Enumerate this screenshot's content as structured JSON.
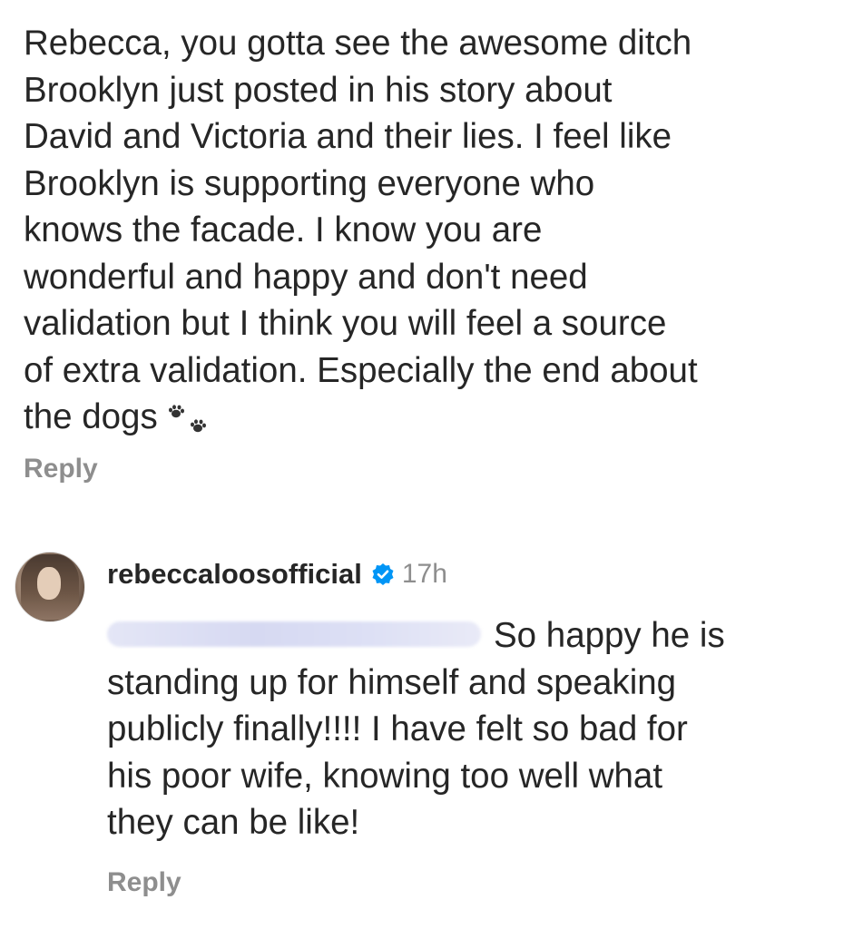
{
  "first_comment": {
    "lines": [
      "Rebecca, you gotta see the awesome ditch",
      "Brooklyn just posted in his story about",
      "David and Victoria and their lies. I feel like",
      "Brooklyn is supporting everyone who",
      "knows the facade. I know you are",
      "wonderful and happy and don't need",
      "validation but I think you will feel a source",
      "of extra validation. Especially the end about",
      "the dogs"
    ],
    "emoji": "paw-prints-icon",
    "reply_label": "Reply"
  },
  "second_comment": {
    "username": "rebeccaloosofficial",
    "verified": true,
    "time": "17h",
    "mention_hidden": true,
    "lines": [
      "So happy he is",
      "standing up for himself and speaking",
      "publicly finally!!!! I have felt so bad for",
      "his poor wife, knowing too well what",
      "they can be like!"
    ],
    "reply_label": "Reply"
  },
  "colors": {
    "text": "#262626",
    "secondary": "#8e8e8e",
    "verified_blue": "#0095f6",
    "mention_blur": "#d6d9f2"
  }
}
